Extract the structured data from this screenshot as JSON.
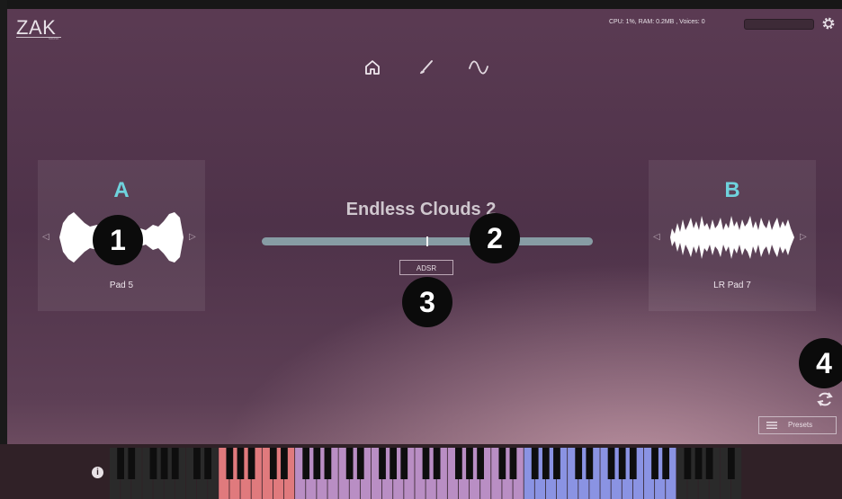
{
  "header": {
    "logo": "ZAK",
    "logo_sub": "sound",
    "status": "CPU: 1%, RAM: 0.2MB , Voices: 0",
    "gear_icon": "gear-icon"
  },
  "nav": {
    "items": [
      {
        "name": "home",
        "icon": "home-icon"
      },
      {
        "name": "edit",
        "icon": "brush-icon"
      },
      {
        "name": "wave",
        "icon": "sine-wave-icon"
      }
    ]
  },
  "layer_a": {
    "letter": "A",
    "sample": "Pad 5"
  },
  "layer_b": {
    "letter": "B",
    "sample": "LR Pad 7"
  },
  "main": {
    "preset_title": "Endless Clouds 2",
    "mix_value": 0.5,
    "adsr_label": "ADSR"
  },
  "badges": [
    "1",
    "2",
    "3",
    "4"
  ],
  "footer": {
    "presets_label": "Presets",
    "info_label": "i"
  },
  "keyboard": {
    "zones": [
      {
        "name": "low-keys",
        "color": "#2a2a2a"
      },
      {
        "name": "red-zone",
        "color": "#e07a7d"
      },
      {
        "name": "purple-zone",
        "color": "#b98ec4"
      },
      {
        "name": "blue-zone",
        "color": "#8a93e3"
      },
      {
        "name": "high-keys",
        "color": "#2a2a2a"
      }
    ]
  },
  "colors": {
    "accent_cyan": "#6fd3dd",
    "slider": "#879ca4"
  }
}
